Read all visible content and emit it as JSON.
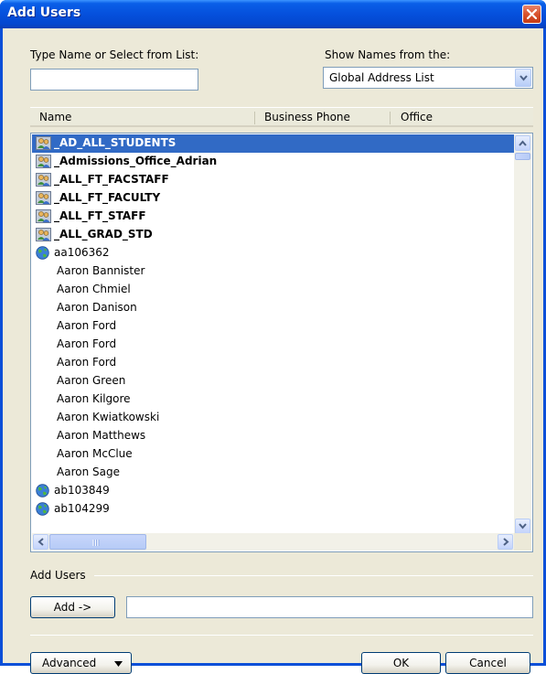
{
  "window": {
    "title": "Add Users"
  },
  "filter": {
    "type_label": "Type Name or Select from List:",
    "type_value": "",
    "show_label": "Show Names from the:",
    "show_value": "Global Address List"
  },
  "columns": [
    "Name",
    "Business Phone",
    "Office"
  ],
  "names": [
    {
      "name": "_AD_ALL_STUDENTS",
      "icon": "group-icon",
      "bold": true,
      "selected": true
    },
    {
      "name": "_Admissions_Office_Adrian",
      "icon": "group-icon",
      "bold": true,
      "selected": false
    },
    {
      "name": "_ALL_FT_FACSTAFF",
      "icon": "group-icon",
      "bold": true,
      "selected": false
    },
    {
      "name": "_ALL_FT_FACULTY",
      "icon": "group-icon",
      "bold": true,
      "selected": false
    },
    {
      "name": "_ALL_FT_STAFF",
      "icon": "group-icon",
      "bold": true,
      "selected": false
    },
    {
      "name": "_ALL_GRAD_STD",
      "icon": "group-icon",
      "bold": true,
      "selected": false
    },
    {
      "name": "aa106362",
      "icon": "globe-icon",
      "bold": false,
      "selected": false
    },
    {
      "name": "Aaron Bannister",
      "icon": "",
      "bold": false,
      "selected": false
    },
    {
      "name": "Aaron Chmiel",
      "icon": "",
      "bold": false,
      "selected": false
    },
    {
      "name": "Aaron Danison",
      "icon": "",
      "bold": false,
      "selected": false
    },
    {
      "name": "Aaron Ford",
      "icon": "",
      "bold": false,
      "selected": false
    },
    {
      "name": "Aaron Ford",
      "icon": "",
      "bold": false,
      "selected": false
    },
    {
      "name": "Aaron Ford",
      "icon": "",
      "bold": false,
      "selected": false
    },
    {
      "name": "Aaron Green",
      "icon": "",
      "bold": false,
      "selected": false
    },
    {
      "name": "Aaron Kilgore",
      "icon": "",
      "bold": false,
      "selected": false
    },
    {
      "name": "Aaron Kwiatkowski",
      "icon": "",
      "bold": false,
      "selected": false
    },
    {
      "name": "Aaron Matthews",
      "icon": "",
      "bold": false,
      "selected": false
    },
    {
      "name": "Aaron McClue",
      "icon": "",
      "bold": false,
      "selected": false
    },
    {
      "name": "Aaron Sage",
      "icon": "",
      "bold": false,
      "selected": false
    },
    {
      "name": "ab103849",
      "icon": "globe-icon",
      "bold": false,
      "selected": false
    },
    {
      "name": "ab104299",
      "icon": "globe-icon",
      "bold": false,
      "selected": false
    }
  ],
  "add_users": {
    "section_label": "Add Users",
    "add_button": "Add ->",
    "field_value": ""
  },
  "footer": {
    "advanced_button": "Advanced",
    "ok_button": "OK",
    "cancel_button": "Cancel"
  },
  "colors": {
    "titlebar": "#0550dc",
    "selection": "#316ac5",
    "dialog_bg": "#ece9d8",
    "close_button": "#d9532d"
  }
}
